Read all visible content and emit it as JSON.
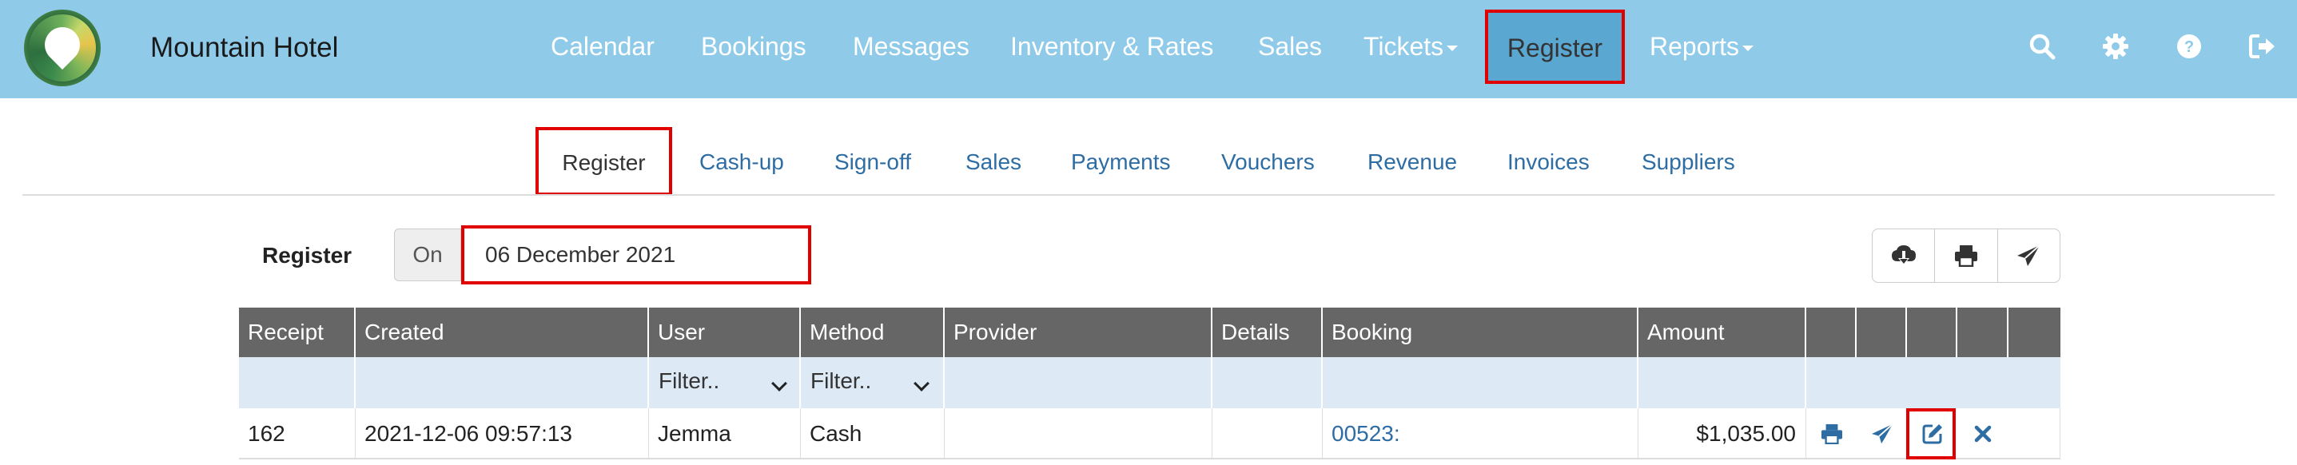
{
  "app": {
    "name": "Mountain Hotel"
  },
  "nav": {
    "items": [
      {
        "label": "Calendar"
      },
      {
        "label": "Bookings"
      },
      {
        "label": "Messages"
      },
      {
        "label": "Inventory & Rates"
      },
      {
        "label": "Sales"
      },
      {
        "label": "Tickets"
      },
      {
        "label": "Register"
      },
      {
        "label": "Reports"
      }
    ],
    "active": "Register",
    "icons": [
      "search-icon",
      "gear-icon",
      "help-icon",
      "logout-icon"
    ]
  },
  "subtabs": {
    "items": [
      {
        "label": "Register"
      },
      {
        "label": "Cash-up"
      },
      {
        "label": "Sign-off"
      },
      {
        "label": "Sales"
      },
      {
        "label": "Payments"
      },
      {
        "label": "Vouchers"
      },
      {
        "label": "Revenue"
      },
      {
        "label": "Invoices"
      },
      {
        "label": "Suppliers"
      }
    ],
    "active": "Register"
  },
  "register": {
    "label": "Register",
    "on_label": "On",
    "date": "06 December 2021",
    "toolbar_icons": [
      "cloud-download-icon",
      "print-icon",
      "send-icon"
    ]
  },
  "table": {
    "headers": [
      "Receipt",
      "Created",
      "User",
      "Method",
      "Provider",
      "Details",
      "Booking",
      "Amount"
    ],
    "filters": {
      "user": "Filter..",
      "method": "Filter.."
    },
    "rows": [
      {
        "receipt": "162",
        "created": "2021-12-06 09:57:13",
        "user": "Jemma",
        "method": "Cash",
        "provider": "",
        "details": "",
        "booking": "00523:",
        "amount": "$1,035.00"
      }
    ],
    "row_actions": [
      "print-icon",
      "send-icon",
      "edit-icon",
      "delete-icon"
    ]
  },
  "colors": {
    "navbar": "#8fcbe9",
    "nav_active": "#5aa8d2",
    "link": "#2e6da4",
    "table_header": "#666666",
    "filter_row": "#ddeaf5",
    "highlight": "#e00000"
  }
}
